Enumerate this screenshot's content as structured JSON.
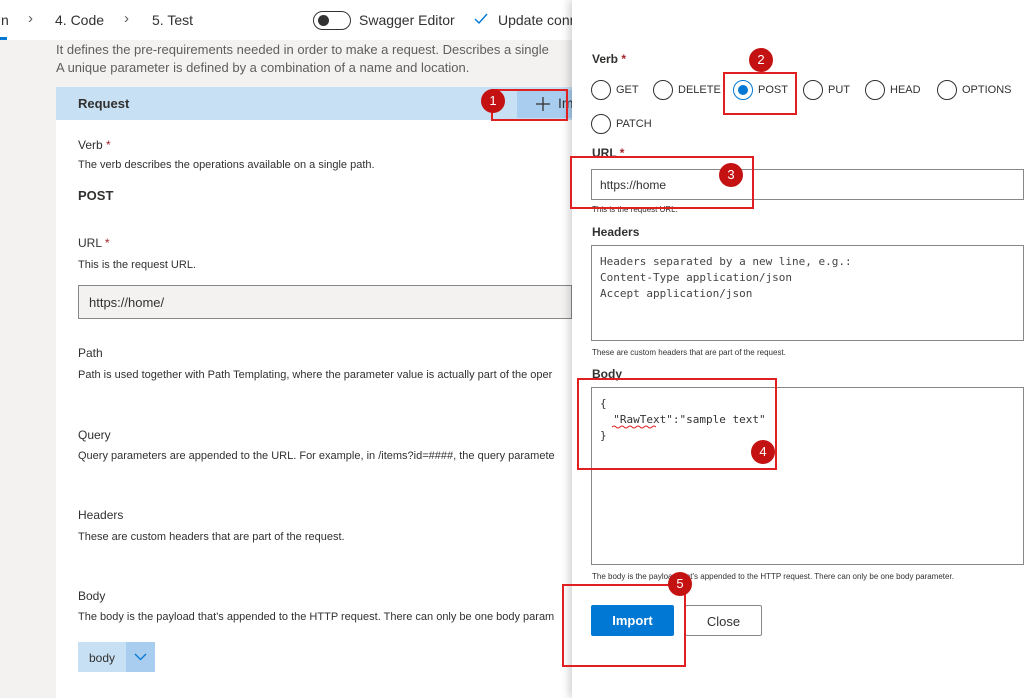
{
  "wizard": {
    "steps": [
      {
        "label": "n"
      },
      {
        "label": "4. Code"
      },
      {
        "label": "5. Test"
      }
    ],
    "swagger_label": "Swagger Editor",
    "update_label": "Update conn"
  },
  "left": {
    "description_line1": "It defines the pre-requirements needed in order to make a request. Describes a single",
    "description_line2": "A unique parameter is defined by a combination of a name and location.",
    "request_title": "Request",
    "import_label": "Im",
    "verb": {
      "label": "Verb",
      "required": "*",
      "help": "The verb describes the operations available on a single path.",
      "value": "POST"
    },
    "url": {
      "label": "URL",
      "required": "*",
      "help": "This is the request URL.",
      "value": "https://home/"
    },
    "path": {
      "label": "Path",
      "help": "Path is used together with Path Templating, where the parameter value is actually part of the oper"
    },
    "query": {
      "label": "Query",
      "help": "Query parameters are appended to the URL. For example, in /items?id=####, the query paramete"
    },
    "headers": {
      "label": "Headers",
      "help": "These are custom headers that are part of the request."
    },
    "body": {
      "label": "Body",
      "help": "The body is the payload that's appended to the HTTP request. There can only be one body param",
      "chip": "body"
    }
  },
  "panel": {
    "verb_label": "Verb",
    "required": "*",
    "verbs": [
      {
        "label": "GET",
        "selected": false
      },
      {
        "label": "DELETE",
        "selected": false
      },
      {
        "label": "POST",
        "selected": true
      },
      {
        "label": "PUT",
        "selected": false
      },
      {
        "label": "HEAD",
        "selected": false
      },
      {
        "label": "OPTIONS",
        "selected": false
      },
      {
        "label": "PATCH",
        "selected": false
      }
    ],
    "url_label": "URL",
    "url_value": "https://home",
    "url_help": "This is the request URL.",
    "headers_label": "Headers",
    "headers_placeholder": "Headers separated by a new line, e.g.:\nContent-Type application/json\nAccept application/json",
    "headers_help": "These are custom headers that are part of the request.",
    "body_label": "Body",
    "body_value": "{\n  \"RawText\":\"sample text\"\n}",
    "body_help": "The body is the payload that's appended to the HTTP request. There can only be one body parameter.",
    "import_button": "Import",
    "close_button": "Close"
  },
  "annotations": [
    "1",
    "2",
    "3",
    "4",
    "5"
  ],
  "colors": {
    "accent": "#0078d4",
    "annotation": "#e02020",
    "header_band": "#c7e0f4"
  }
}
